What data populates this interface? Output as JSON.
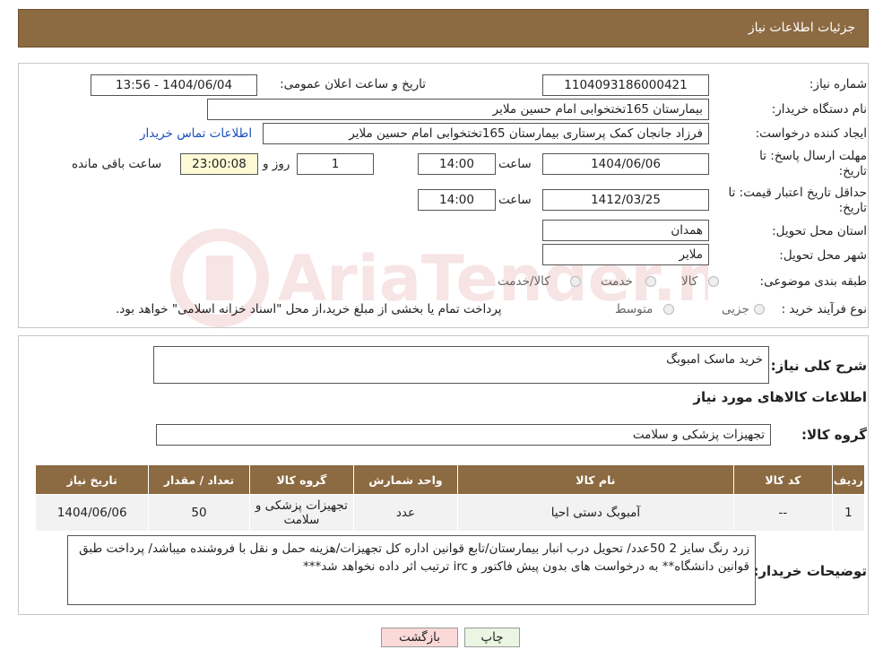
{
  "header": {
    "title": "جزئیات اطلاعات نیاز"
  },
  "form": {
    "need_number_label": "شماره نیاز:",
    "need_number": "1104093186000421",
    "announce_label": "تاریخ و ساعت اعلان عمومی:",
    "announce_value": "1404/06/04 - 13:56",
    "buyer_org_label": "نام دستگاه خریدار:",
    "buyer_org": "بیمارستان 165تختخوابی امام حسین ملایر",
    "creator_label": "ایجاد کننده درخواست:",
    "creator": "فرزاد جانجان کمک پرستاری بیمارستان 165تختخوابی امام حسین ملایر",
    "contact_link": "اطلاعات تماس خریدار",
    "deadline_label_1": "مهلت ارسال پاسخ: تا",
    "deadline_label_2": "تاریخ:",
    "deadline_date": "1404/06/06",
    "time_label": "ساعت",
    "deadline_time": "14:00",
    "days_value": "1",
    "days_label": "روز و",
    "remaining_time": "23:00:08",
    "remaining_label": "ساعت باقی مانده",
    "validity_label_1": "حداقل تاریخ اعتبار قیمت: تا",
    "validity_label_2": "تاریخ:",
    "validity_date": "1412/03/25",
    "validity_time": "14:00",
    "province_label": "استان محل تحویل:",
    "province": "همدان",
    "city_label": "شهر محل تحویل:",
    "city": "ملایر",
    "category_label": "طبقه بندی موضوعی:",
    "category_options": [
      "کالا",
      "خدمت",
      "کالا/خدمت"
    ],
    "process_label": "نوع فرآیند خرید :",
    "process_options": [
      "جزیی",
      "متوسط"
    ],
    "process_note": "پرداخت تمام یا بخشی از مبلغ خرید،از محل \"اسناد خزانه اسلامی\" خواهد بود."
  },
  "details": {
    "summary_label": "شرح کلی نیاز:",
    "summary": "خرید ماسک امبوبگ",
    "goods_info_title": "اطلاعات کالاهای مورد نیاز",
    "group_label": "گروه کالا:",
    "group_value": "تجهیزات پزشکی و سلامت",
    "table": {
      "headers": [
        "ردیف",
        "کد کالا",
        "نام کالا",
        "واحد شمارش",
        "گروه کالا",
        "تعداد / مقدار",
        "تاریخ نیاز"
      ],
      "rows": [
        [
          "1",
          "--",
          "آمبوبگ دستی احیا",
          "عدد",
          "تجهیزات پزشکی و سلامت",
          "50",
          "1404/06/06"
        ]
      ]
    },
    "buyer_notes_label": "توضیحات خریدار:",
    "buyer_notes": "زرد رنگ سایز 2   50عدد/ تحویل درب انبار بیمارستان/تابع قوانین اداره کل تجهیزات/هزینه حمل و نقل با فروشنده میباشد/ پرداخت طبق قوانین دانشگاه** به درخواست های بدون پیش فاکتور و irc ترتیب اثر داده نخواهد شد***"
  },
  "buttons": {
    "print": "چاپ",
    "back": "بازگشت"
  },
  "watermark_text": "AriaTender.neT",
  "colors": {
    "header_bg": "#8c6a42",
    "link": "#1a4fbf",
    "back_btn": "#fbd9d9",
    "print_btn": "#eaf5e2"
  }
}
